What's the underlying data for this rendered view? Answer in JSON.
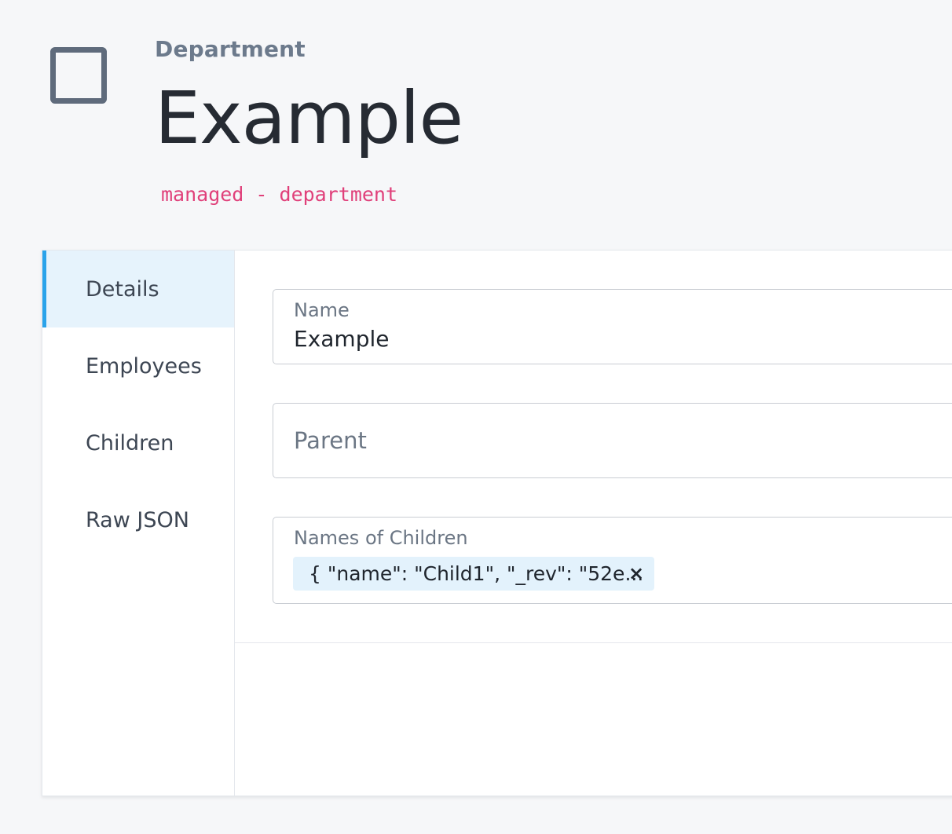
{
  "header": {
    "icon": "square-outline-icon",
    "eyebrow": "Department",
    "title": "Example",
    "subtitle": "managed - department"
  },
  "nav": {
    "items": [
      {
        "label": "Details",
        "active": true
      },
      {
        "label": "Employees",
        "active": false
      },
      {
        "label": "Children",
        "active": false
      },
      {
        "label": "Raw JSON",
        "active": false
      }
    ]
  },
  "form": {
    "name_label": "Name",
    "name_value": "Example",
    "parent_placeholder": "Parent",
    "children_label": "Names of Children",
    "children_chip": "{ \"name\": \"Child1\", \"_rev\": \"52e...",
    "chip_remove_icon": "close-icon",
    "chip_remove_glyph": "×"
  },
  "colors": {
    "accent": "#2aa3ea",
    "subtitle": "#e0407a",
    "active_nav_bg": "#e6f3fc",
    "chip_bg": "#e3f2fc"
  }
}
